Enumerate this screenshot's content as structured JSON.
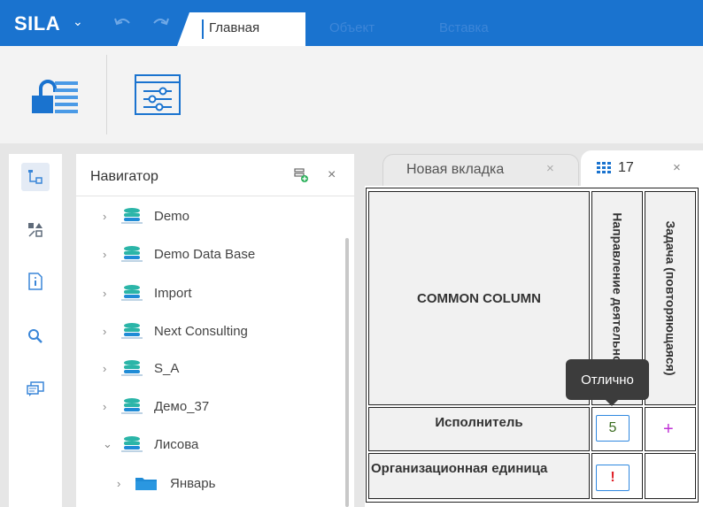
{
  "app": {
    "logo": "SILA",
    "tabs": [
      "Главная",
      "Объект",
      "Вставка"
    ]
  },
  "navigator": {
    "title": "Навигатор",
    "items": [
      {
        "label": "Demo",
        "expanded": false,
        "icon": "database-icon"
      },
      {
        "label": "Demo Data Base",
        "expanded": false,
        "icon": "database-icon"
      },
      {
        "label": "Import",
        "expanded": false,
        "icon": "database-icon"
      },
      {
        "label": "Next Consulting",
        "expanded": false,
        "icon": "database-icon"
      },
      {
        "label": "S_A",
        "expanded": false,
        "icon": "database-icon"
      },
      {
        "label": "Демо_37",
        "expanded": false,
        "icon": "database-icon"
      },
      {
        "label": "Лисова",
        "expanded": true,
        "icon": "database-icon"
      },
      {
        "label": "Январь",
        "expanded": false,
        "icon": "folder-icon"
      }
    ]
  },
  "doc_tabs": [
    {
      "label": "Новая вкладка",
      "active": false
    },
    {
      "label": "17",
      "active": true
    }
  ],
  "table": {
    "corner": "COMMON COLUMN",
    "columns": [
      "Направление деятельности",
      "Задача (повторяющаяся)"
    ],
    "rows": [
      {
        "label": "Исполнитель",
        "values": [
          "5",
          "+"
        ]
      },
      {
        "label": "Организационная единица",
        "values": [
          "!",
          ""
        ]
      }
    ]
  },
  "tooltip": "Отлично",
  "colors": {
    "brand": "#1a73cf",
    "tab_inactive": "#3d86d8",
    "db_top": "#2bb5a8",
    "db_bottom": "#1f8bd6",
    "plus": "#c033d6",
    "alert": "#e0232b",
    "value_green": "#3a6b1e"
  }
}
